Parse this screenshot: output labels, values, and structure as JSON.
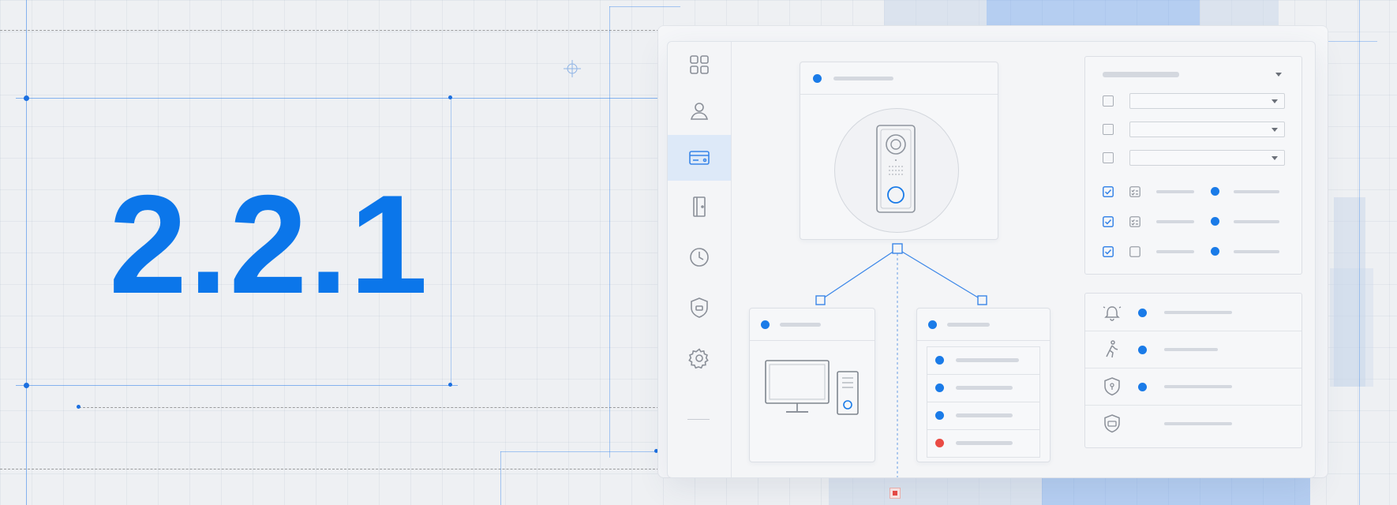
{
  "version": "2.2.1",
  "colors": {
    "accent": "#1a7be8",
    "alert": "#ea4b44",
    "background": "#eef0f3"
  },
  "sidebar": {
    "items": [
      {
        "icon": "grid-icon",
        "active": false
      },
      {
        "icon": "user-icon",
        "active": false
      },
      {
        "icon": "card-icon",
        "active": true
      },
      {
        "icon": "door-icon",
        "active": false
      },
      {
        "icon": "clock-icon",
        "active": false
      },
      {
        "icon": "shield-icon",
        "active": false
      },
      {
        "icon": "gear-icon",
        "active": false
      }
    ]
  },
  "device_card": {
    "icon": "doorbell-intercom-icon"
  },
  "computer_card": {
    "icon": "desktop-computer-icon"
  },
  "device_list": {
    "rows": [
      {
        "status": "online"
      },
      {
        "status": "online"
      },
      {
        "status": "online"
      },
      {
        "status": "offline"
      }
    ]
  },
  "settings_panel": {
    "options": [
      {
        "checked": false
      },
      {
        "checked": false
      },
      {
        "checked": false
      }
    ],
    "permissions": [
      {
        "checked": true,
        "enabled": true
      },
      {
        "checked": true,
        "enabled": true
      },
      {
        "checked": true,
        "enabled": false
      }
    ]
  },
  "events_panel": {
    "rows": [
      {
        "icon": "bell-icon",
        "status": "active"
      },
      {
        "icon": "person-walking-icon",
        "status": "active"
      },
      {
        "icon": "shield-alert-icon",
        "status": "active"
      },
      {
        "icon": "shield-card-icon",
        "status": "none"
      }
    ]
  }
}
